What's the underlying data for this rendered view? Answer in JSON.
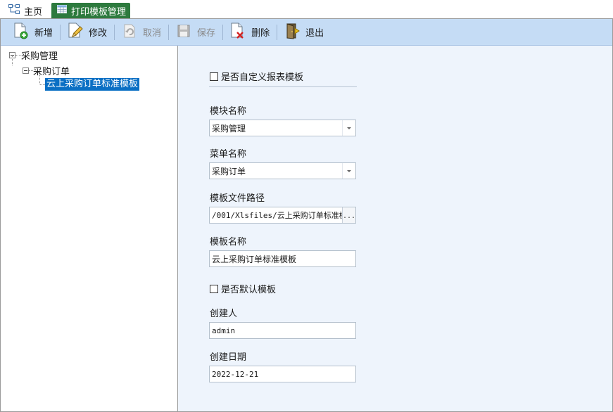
{
  "tabs": {
    "home": "主页",
    "active": "打印模板管理"
  },
  "toolbar": {
    "new": "新增",
    "edit": "修改",
    "cancel": "取消",
    "save": "保存",
    "delete": "删除",
    "exit": "退出"
  },
  "tree": {
    "root": "采购管理",
    "child": "采购订单",
    "leaf": "云上采购订单标准模板"
  },
  "form": {
    "custom_report_label": "是否自定义报表模板",
    "custom_report_checked": false,
    "module_label": "模块名称",
    "module_value": "采购管理",
    "menu_label": "菜单名称",
    "menu_value": "采购订单",
    "path_label": "模板文件路径",
    "path_value": "/001/Xlsfiles/云上采购订单标准模",
    "path_button": "...",
    "template_label": "模板名称",
    "template_value": "云上采购订单标准模板",
    "default_label": "是否默认模板",
    "default_checked": false,
    "creator_label": "创建人",
    "creator_value": "admin",
    "date_label": "创建日期",
    "date_value": "2022-12-21"
  },
  "colors": {
    "active_tab": "#2d7a3e",
    "toolbar": "#c5dcf5",
    "selection": "#0a6fc4",
    "form_bg": "#eef4fc"
  }
}
